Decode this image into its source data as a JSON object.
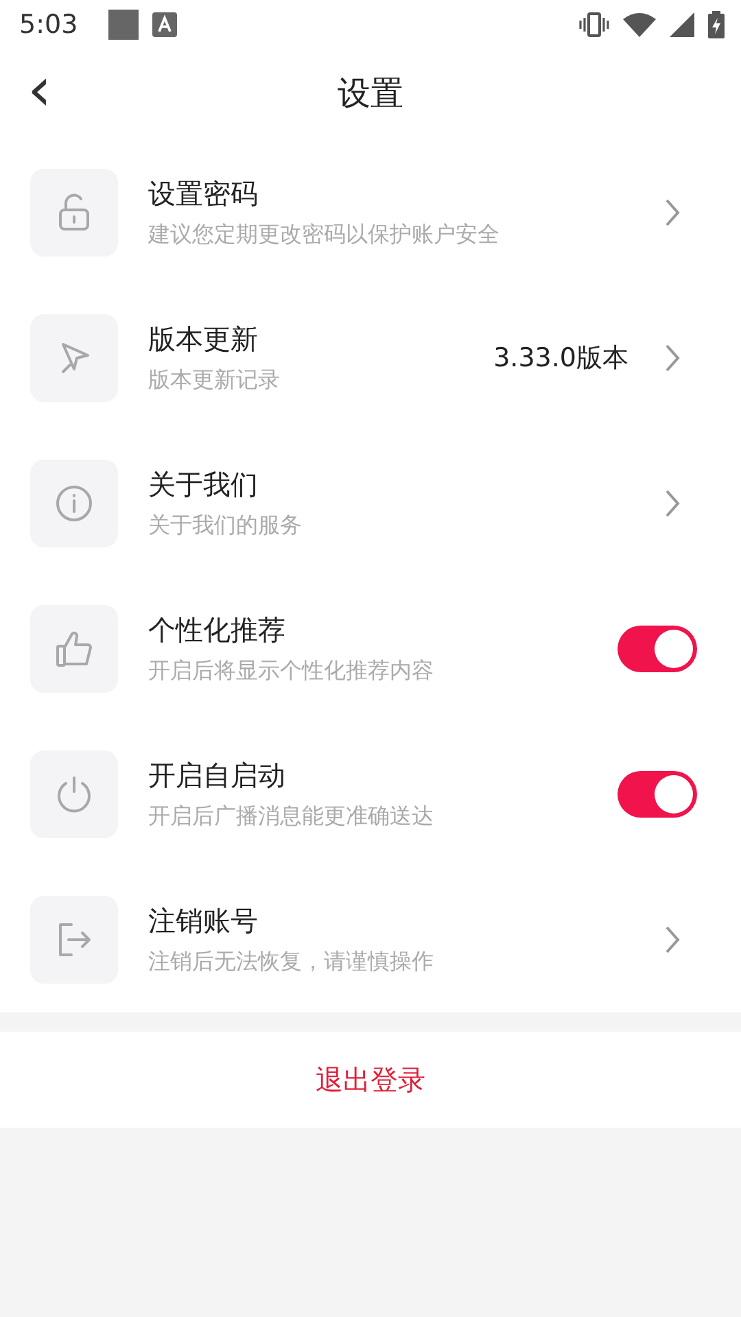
{
  "status_bar": {
    "time": "5:03"
  },
  "header": {
    "back": "‹",
    "title": "设置"
  },
  "items": [
    {
      "kind": "link",
      "title": "设置密码",
      "subtitle": "建议您定期更改密码以保护账户安全"
    },
    {
      "kind": "link",
      "title": "版本更新",
      "subtitle": "版本更新记录",
      "value": "3.33.0版本"
    },
    {
      "kind": "link",
      "title": "关于我们",
      "subtitle": "关于我们的服务"
    },
    {
      "kind": "toggle",
      "title": "个性化推荐",
      "subtitle": "开启后将显示个性化推荐内容",
      "on": true
    },
    {
      "kind": "toggle",
      "title": "开启自启动",
      "subtitle": "开启后广播消息能更准确送达",
      "on": true
    },
    {
      "kind": "link",
      "title": "注销账号",
      "subtitle": "注销后无法恢复，请谨慎操作"
    }
  ],
  "logout_button": "退出登录"
}
